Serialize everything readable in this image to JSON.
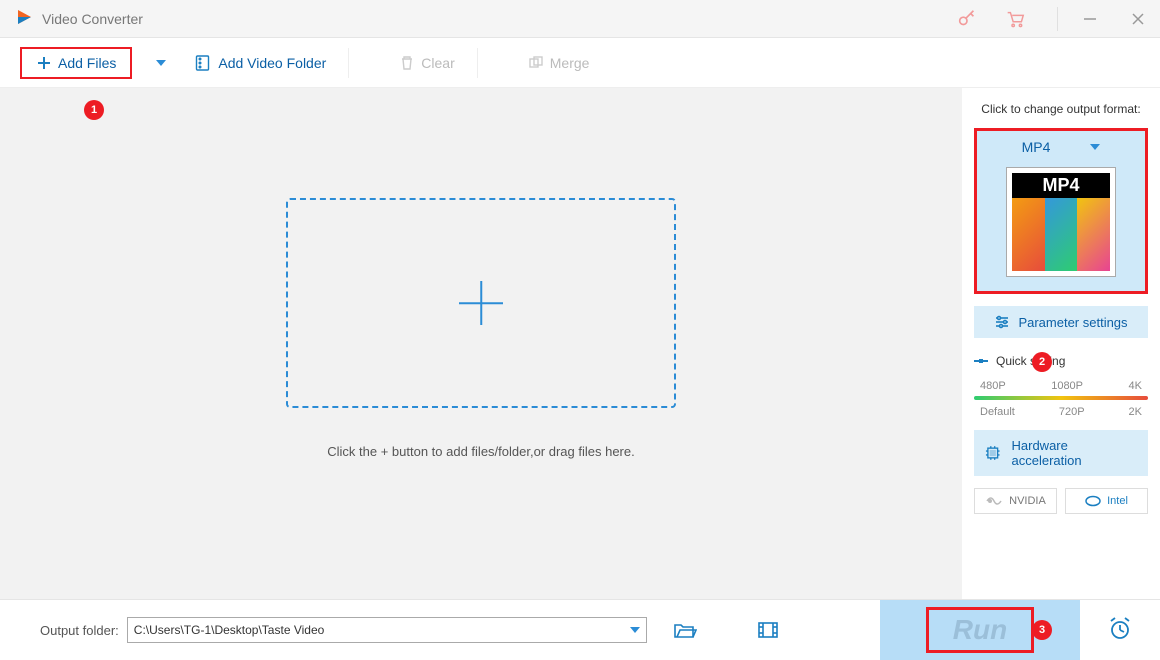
{
  "app": {
    "title": "Video Converter"
  },
  "toolbar": {
    "add_files": "Add Files",
    "add_folder": "Add Video Folder",
    "clear": "Clear",
    "merge": "Merge"
  },
  "badges": {
    "b1": "1",
    "b2": "2",
    "b3": "3"
  },
  "stage": {
    "hint": "Click the + button to add files/folder,or drag files here."
  },
  "sidebar": {
    "change_label": "Click to change output format:",
    "format_name": "MP4",
    "thumb_label": "MP4",
    "param_settings": "Parameter settings",
    "quick_setting": "Quick setting",
    "presets_top": [
      "480P",
      "1080P",
      "4K"
    ],
    "presets_bottom": [
      "Default",
      "720P",
      "2K"
    ],
    "hw_accel": "Hardware acceleration",
    "vendors": {
      "nvidia": "NVIDIA",
      "intel": "Intel"
    }
  },
  "footer": {
    "label": "Output folder:",
    "path": "C:\\Users\\TG-1\\Desktop\\Taste Video",
    "run": "Run"
  }
}
